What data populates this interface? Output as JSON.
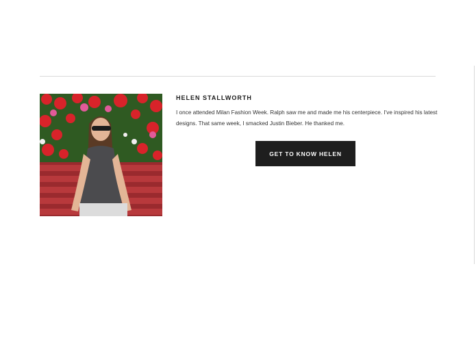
{
  "author": {
    "name": "HELEN STALLWORTH",
    "bio": "I once attended Milan Fashion Week. Ralph saw me and made me his centerpiece. I've inspired his latest designs. That same week, I smacked Justin Bieber. He thanked me.",
    "cta_label": "GET TO KNOW HELEN",
    "photo_icon": "author-photo"
  },
  "colors": {
    "button_bg": "#1e1e1e",
    "button_text": "#ffffff",
    "divider": "#d9d9d9",
    "name_text": "#1a1a1a",
    "bio_text": "#333333"
  }
}
